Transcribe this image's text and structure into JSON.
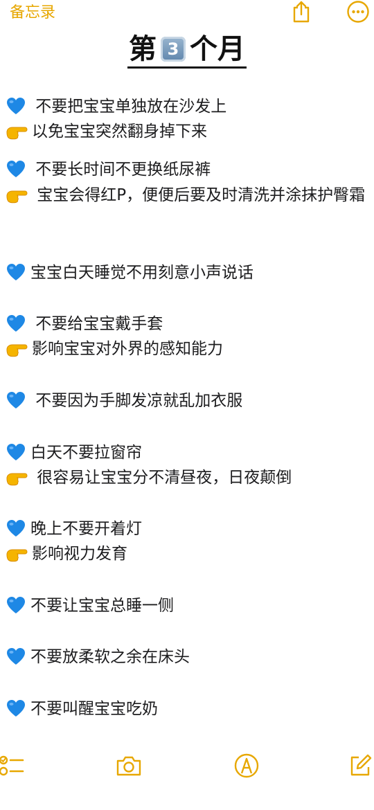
{
  "nav": {
    "back_label": "备忘录",
    "icons": [
      "share-icon",
      "more-icon"
    ],
    "accent_color": "#e7a700"
  },
  "note": {
    "title_prefix": "第",
    "title_keycap": "3",
    "title_suffix": "个月",
    "lines": [
      {
        "emoji": "blue-heart-icon",
        "text": " 不要把宝宝单独放在沙发上"
      },
      {
        "emoji": "pointing-hand-icon",
        "text": "以免宝宝突然翻身掉下来"
      },
      {
        "emoji": "blue-heart-icon",
        "text": " 不要长时间不更换纸尿裤"
      },
      {
        "emoji": "pointing-hand-icon",
        "text": " 宝宝会得红P，便便后要及时清洗并涂抹护臀霜"
      },
      {
        "emoji": "blue-heart-icon",
        "text": "宝宝白天睡觉不用刻意小声说话"
      },
      {
        "emoji": "blue-heart-icon",
        "text": " 不要给宝宝戴手套"
      },
      {
        "emoji": "pointing-hand-icon",
        "text": "影响宝宝对外界的感知能力"
      },
      {
        "emoji": "blue-heart-icon",
        "text": " 不要因为手脚发凉就乱加衣服"
      },
      {
        "emoji": "blue-heart-icon",
        "text": "白天不要拉窗帘"
      },
      {
        "emoji": "pointing-hand-icon",
        "text": " 很容易让宝宝分不清昼夜，日夜颠倒"
      },
      {
        "emoji": "blue-heart-icon",
        "text": "晚上不要开着灯"
      },
      {
        "emoji": "pointing-hand-icon",
        "text": "影响视力发育"
      },
      {
        "emoji": "blue-heart-icon",
        "text": "不要让宝宝总睡一侧"
      },
      {
        "emoji": "blue-heart-icon",
        "text": "不要放柔软之余在床头"
      },
      {
        "emoji": "blue-heart-icon",
        "text": "不要叫醒宝宝吃奶"
      }
    ]
  },
  "toolbar": {
    "icons": [
      "checklist-icon",
      "camera-icon",
      "markup-icon",
      "compose-icon"
    ]
  },
  "colors": {
    "heart_blue": "#1e88e5",
    "hand_yellow": "#f5b400",
    "accent": "#e7a700"
  }
}
